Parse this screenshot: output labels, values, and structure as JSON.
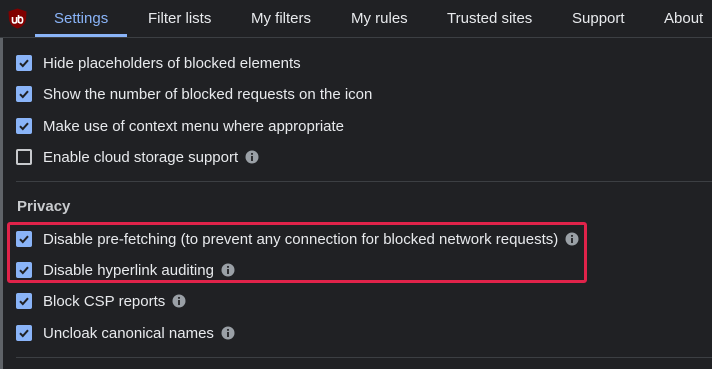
{
  "nav": {
    "logo": "ublock-origin-logo",
    "tabs": [
      {
        "label": "Settings",
        "active": true
      },
      {
        "label": "Filter lists",
        "active": false
      },
      {
        "label": "My filters",
        "active": false
      },
      {
        "label": "My rules",
        "active": false
      },
      {
        "label": "Trusted sites",
        "active": false
      },
      {
        "label": "Support",
        "active": false
      },
      {
        "label": "About",
        "active": false
      }
    ]
  },
  "appearance": {
    "options": [
      {
        "label": "Hide placeholders of blocked elements",
        "checked": true,
        "info": false
      },
      {
        "label": "Show the number of blocked requests on the icon",
        "checked": true,
        "info": false
      },
      {
        "label": "Make use of context menu where appropriate",
        "checked": true,
        "info": false
      },
      {
        "label": "Enable cloud storage support",
        "checked": false,
        "info": true
      }
    ]
  },
  "privacy": {
    "title": "Privacy",
    "options": [
      {
        "label": "Disable pre-fetching (to prevent any connection for blocked network requests)",
        "checked": true,
        "info": true
      },
      {
        "label": "Disable hyperlink auditing",
        "checked": true,
        "info": true
      },
      {
        "label": "Block CSP reports",
        "checked": true,
        "info": true
      },
      {
        "label": "Uncloak canonical names",
        "checked": true,
        "info": true
      }
    ]
  },
  "colors": {
    "accent": "#8ab4f8",
    "background": "#202124",
    "highlight": "#e0234a",
    "logo_red": "#800000"
  },
  "icons": {
    "check": "check-icon",
    "info": "info-icon"
  }
}
